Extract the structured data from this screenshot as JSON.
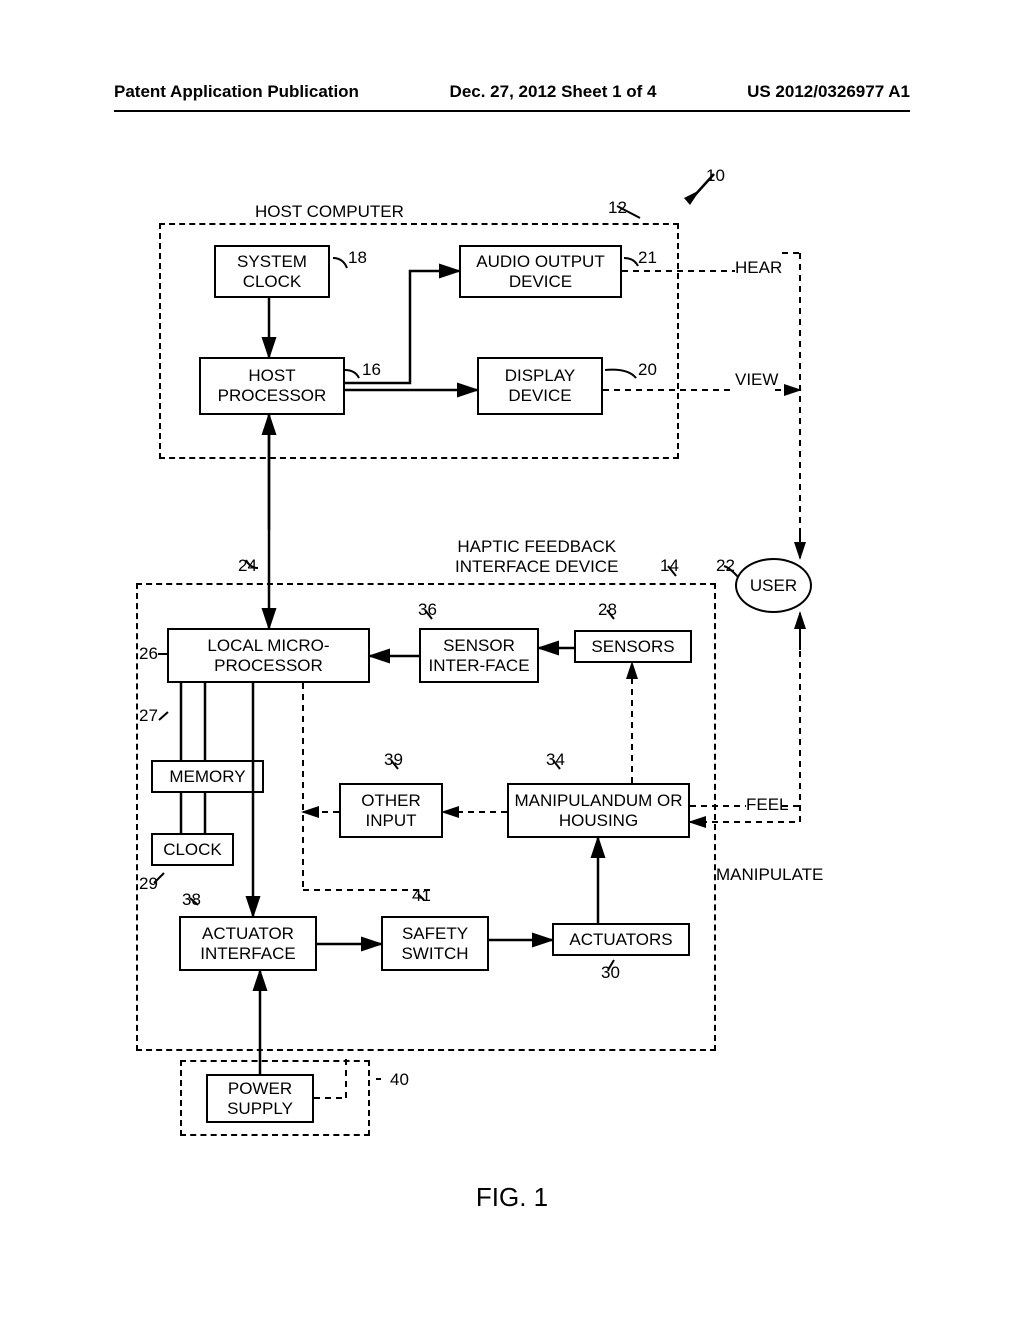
{
  "header": {
    "left": "Patent Application Publication",
    "center": "Dec. 27, 2012  Sheet 1 of 4",
    "right": "US 2012/0326977 A1"
  },
  "groups": {
    "host": "HOST COMPUTER",
    "haptic": "HAPTIC FEEDBACK\nINTERFACE DEVICE"
  },
  "blocks": {
    "system_clock": "SYSTEM\nCLOCK",
    "host_processor": "HOST\nPROCESSOR",
    "audio_output": "AUDIO OUTPUT\nDEVICE",
    "display_device": "DISPLAY\nDEVICE",
    "local_micro": "LOCAL\nMICRO-PROCESSOR",
    "sensor_interface": "SENSOR\nINTER-FACE",
    "sensors": "SENSORS",
    "memory": "MEMORY",
    "clock": "CLOCK",
    "other_input": "OTHER\nINPUT",
    "manipulandum": "MANIPULANDUM\nOR HOUSING",
    "actuator_interface": "ACTUATOR\nINTERFACE",
    "safety_switch": "SAFETY\nSWITCH",
    "actuators": "ACTUATORS",
    "power_supply": "POWER\nSUPPLY",
    "user": "USER"
  },
  "user_labels": {
    "hear": "HEAR",
    "view": "VIEW",
    "feel": "FEEL",
    "manipulate": "MANIPULATE"
  },
  "refs": {
    "r10": "10",
    "r12": "12",
    "r14": "14",
    "r16": "16",
    "r18": "18",
    "r20": "20",
    "r21": "21",
    "r22": "22",
    "r24": "24",
    "r26": "26",
    "r27": "27",
    "r28": "28",
    "r29": "29",
    "r30": "30",
    "r34": "34",
    "r36": "36",
    "r38": "38",
    "r39": "39",
    "r40": "40",
    "r41": "41"
  },
  "figure": "FIG. 1"
}
